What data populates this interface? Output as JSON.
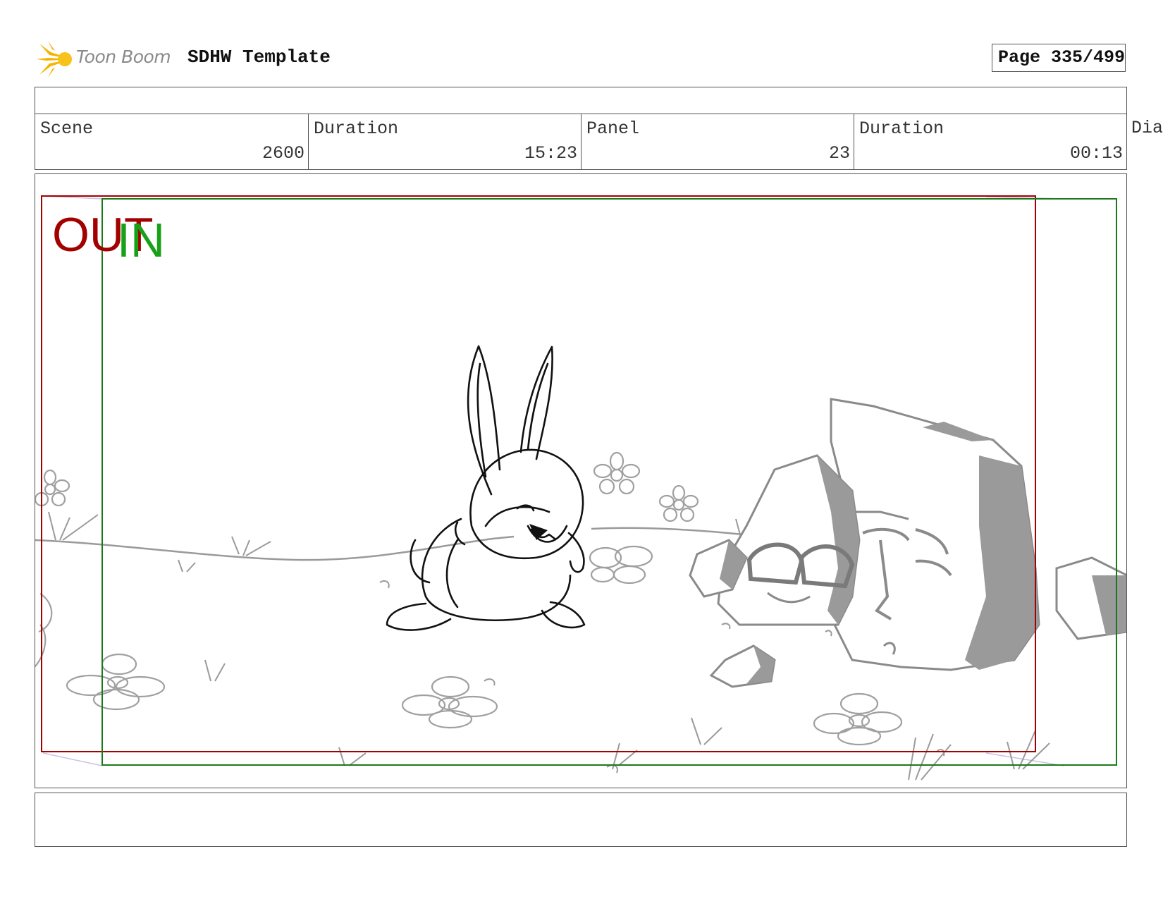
{
  "header": {
    "logo_text": "Toon Boom",
    "doc_title": "SDHW Template",
    "page_label": "Page 335/499"
  },
  "info": {
    "scene_label": "Scene",
    "scene_value": "2600",
    "duration_label": "Duration",
    "duration_value": "15:23",
    "panel_label": "Panel",
    "panel_value": "23",
    "panel_duration_label": "Duration",
    "panel_duration_value": "00:13",
    "dialog_label": "Dia"
  },
  "panel": {
    "out_label": "OUT",
    "in_label": "IN",
    "out_color": "#a30000",
    "in_color": "#18a018",
    "sketch_subject": "bunny-and-rocks-sketch"
  },
  "colors": {
    "logo_burst": "#f5b400",
    "frame_border": "#555555"
  }
}
